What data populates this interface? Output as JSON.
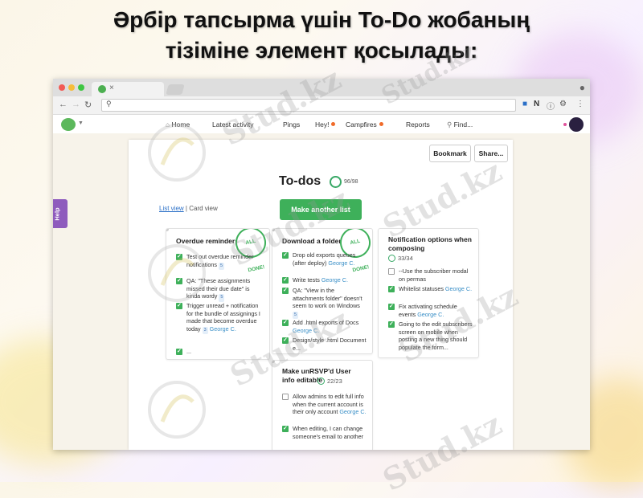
{
  "slide": {
    "title_line1": "Әрбір тапсырма үшін  To-Do жобаның",
    "title_line2": "тізіміне элемент қосылады:"
  },
  "watermark": {
    "text": "Stud.kz"
  },
  "nav": {
    "items": [
      "Home",
      "Latest activity",
      "Pings",
      "Hey!",
      "Campfires",
      "Reports",
      "Find..."
    ]
  },
  "help_label": "Help",
  "page": {
    "bookmark_label": "Bookmark",
    "share_label": "Share...",
    "title": "To-dos",
    "progress": "96/98",
    "make_list_label": "Make another list",
    "list_view": "List view",
    "card_view": "Card view"
  },
  "badge_text": "ALL DONE!",
  "lists": [
    {
      "title": "Overdue reminders",
      "items": [
        {
          "checked": true,
          "text": "Test out overdue reminder notifications",
          "count": "5"
        },
        {
          "checked": true,
          "text": "QA: \"These assignments missed their due date\" is kinda wordy",
          "count": "5"
        },
        {
          "checked": true,
          "text": "Trigger unread + notification for the bundle of assignings I made that become overdue today",
          "count": "3",
          "assignee": "George C."
        },
        {
          "checked": true,
          "text": "..."
        }
      ]
    },
    {
      "title": "Download a folder",
      "items": [
        {
          "checked": true,
          "text": "Drop old exports queues (after deploy)",
          "assignee": "George C."
        },
        {
          "checked": true,
          "text": "Write tests",
          "assignee": "George C."
        },
        {
          "checked": true,
          "text": "QA: \"View in the attachments folder\" doesn't seem to work on Windows",
          "count": "5"
        },
        {
          "checked": true,
          "text": "Add .html exports of Docs",
          "assignee": "George C."
        },
        {
          "checked": true,
          "text": "Design/style .html Document e..."
        }
      ]
    },
    {
      "title": "Notification options when composing",
      "progress": "33/34",
      "items": [
        {
          "checked": false,
          "text": "--Use the subscriber modal on permas"
        },
        {
          "checked": true,
          "text": "Whitelist statuses",
          "assignee": "George C."
        },
        {
          "checked": true,
          "text": "Fix activating schedule events",
          "assignee": "George C."
        },
        {
          "checked": true,
          "text": "Going to the edit subscribers screen on mobile when posting a new thing should populate the form..."
        }
      ]
    },
    {
      "title": "Make unRSVP'd User info editable",
      "progress": "22/23",
      "items": [
        {
          "checked": false,
          "text": "Allow admins to edit full info when the current account is their only account",
          "assignee": "George C."
        },
        {
          "checked": true,
          "text": "When editing, I can change someone's email to another"
        }
      ]
    }
  ],
  "colors": {
    "accent": "#3eb05a",
    "help": "#8e5bbd",
    "link": "#2a6fc7"
  }
}
